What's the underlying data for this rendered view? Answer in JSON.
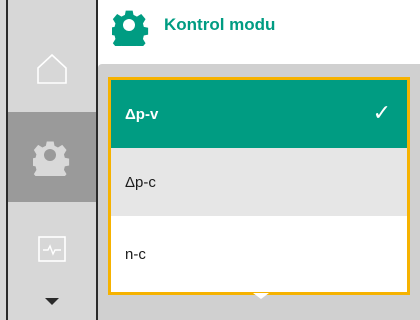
{
  "header": {
    "title": "Kontrol modu",
    "icon": "gear-icon",
    "accent_color": "#009c82"
  },
  "rail": {
    "items": [
      {
        "icon": "home-icon",
        "active": false
      },
      {
        "icon": "gear-icon",
        "active": true
      },
      {
        "icon": "monitor-icon",
        "active": false
      }
    ],
    "more_icon": "chevron-down-icon"
  },
  "list": {
    "border_color": "#f6b200",
    "items": [
      {
        "label": "Δp-v",
        "selected": true
      },
      {
        "label": "Δp-c",
        "selected": false
      },
      {
        "label": "n-c",
        "selected": false
      }
    ],
    "check_glyph": "✓",
    "scroll_icon": "chevron-down-icon"
  }
}
